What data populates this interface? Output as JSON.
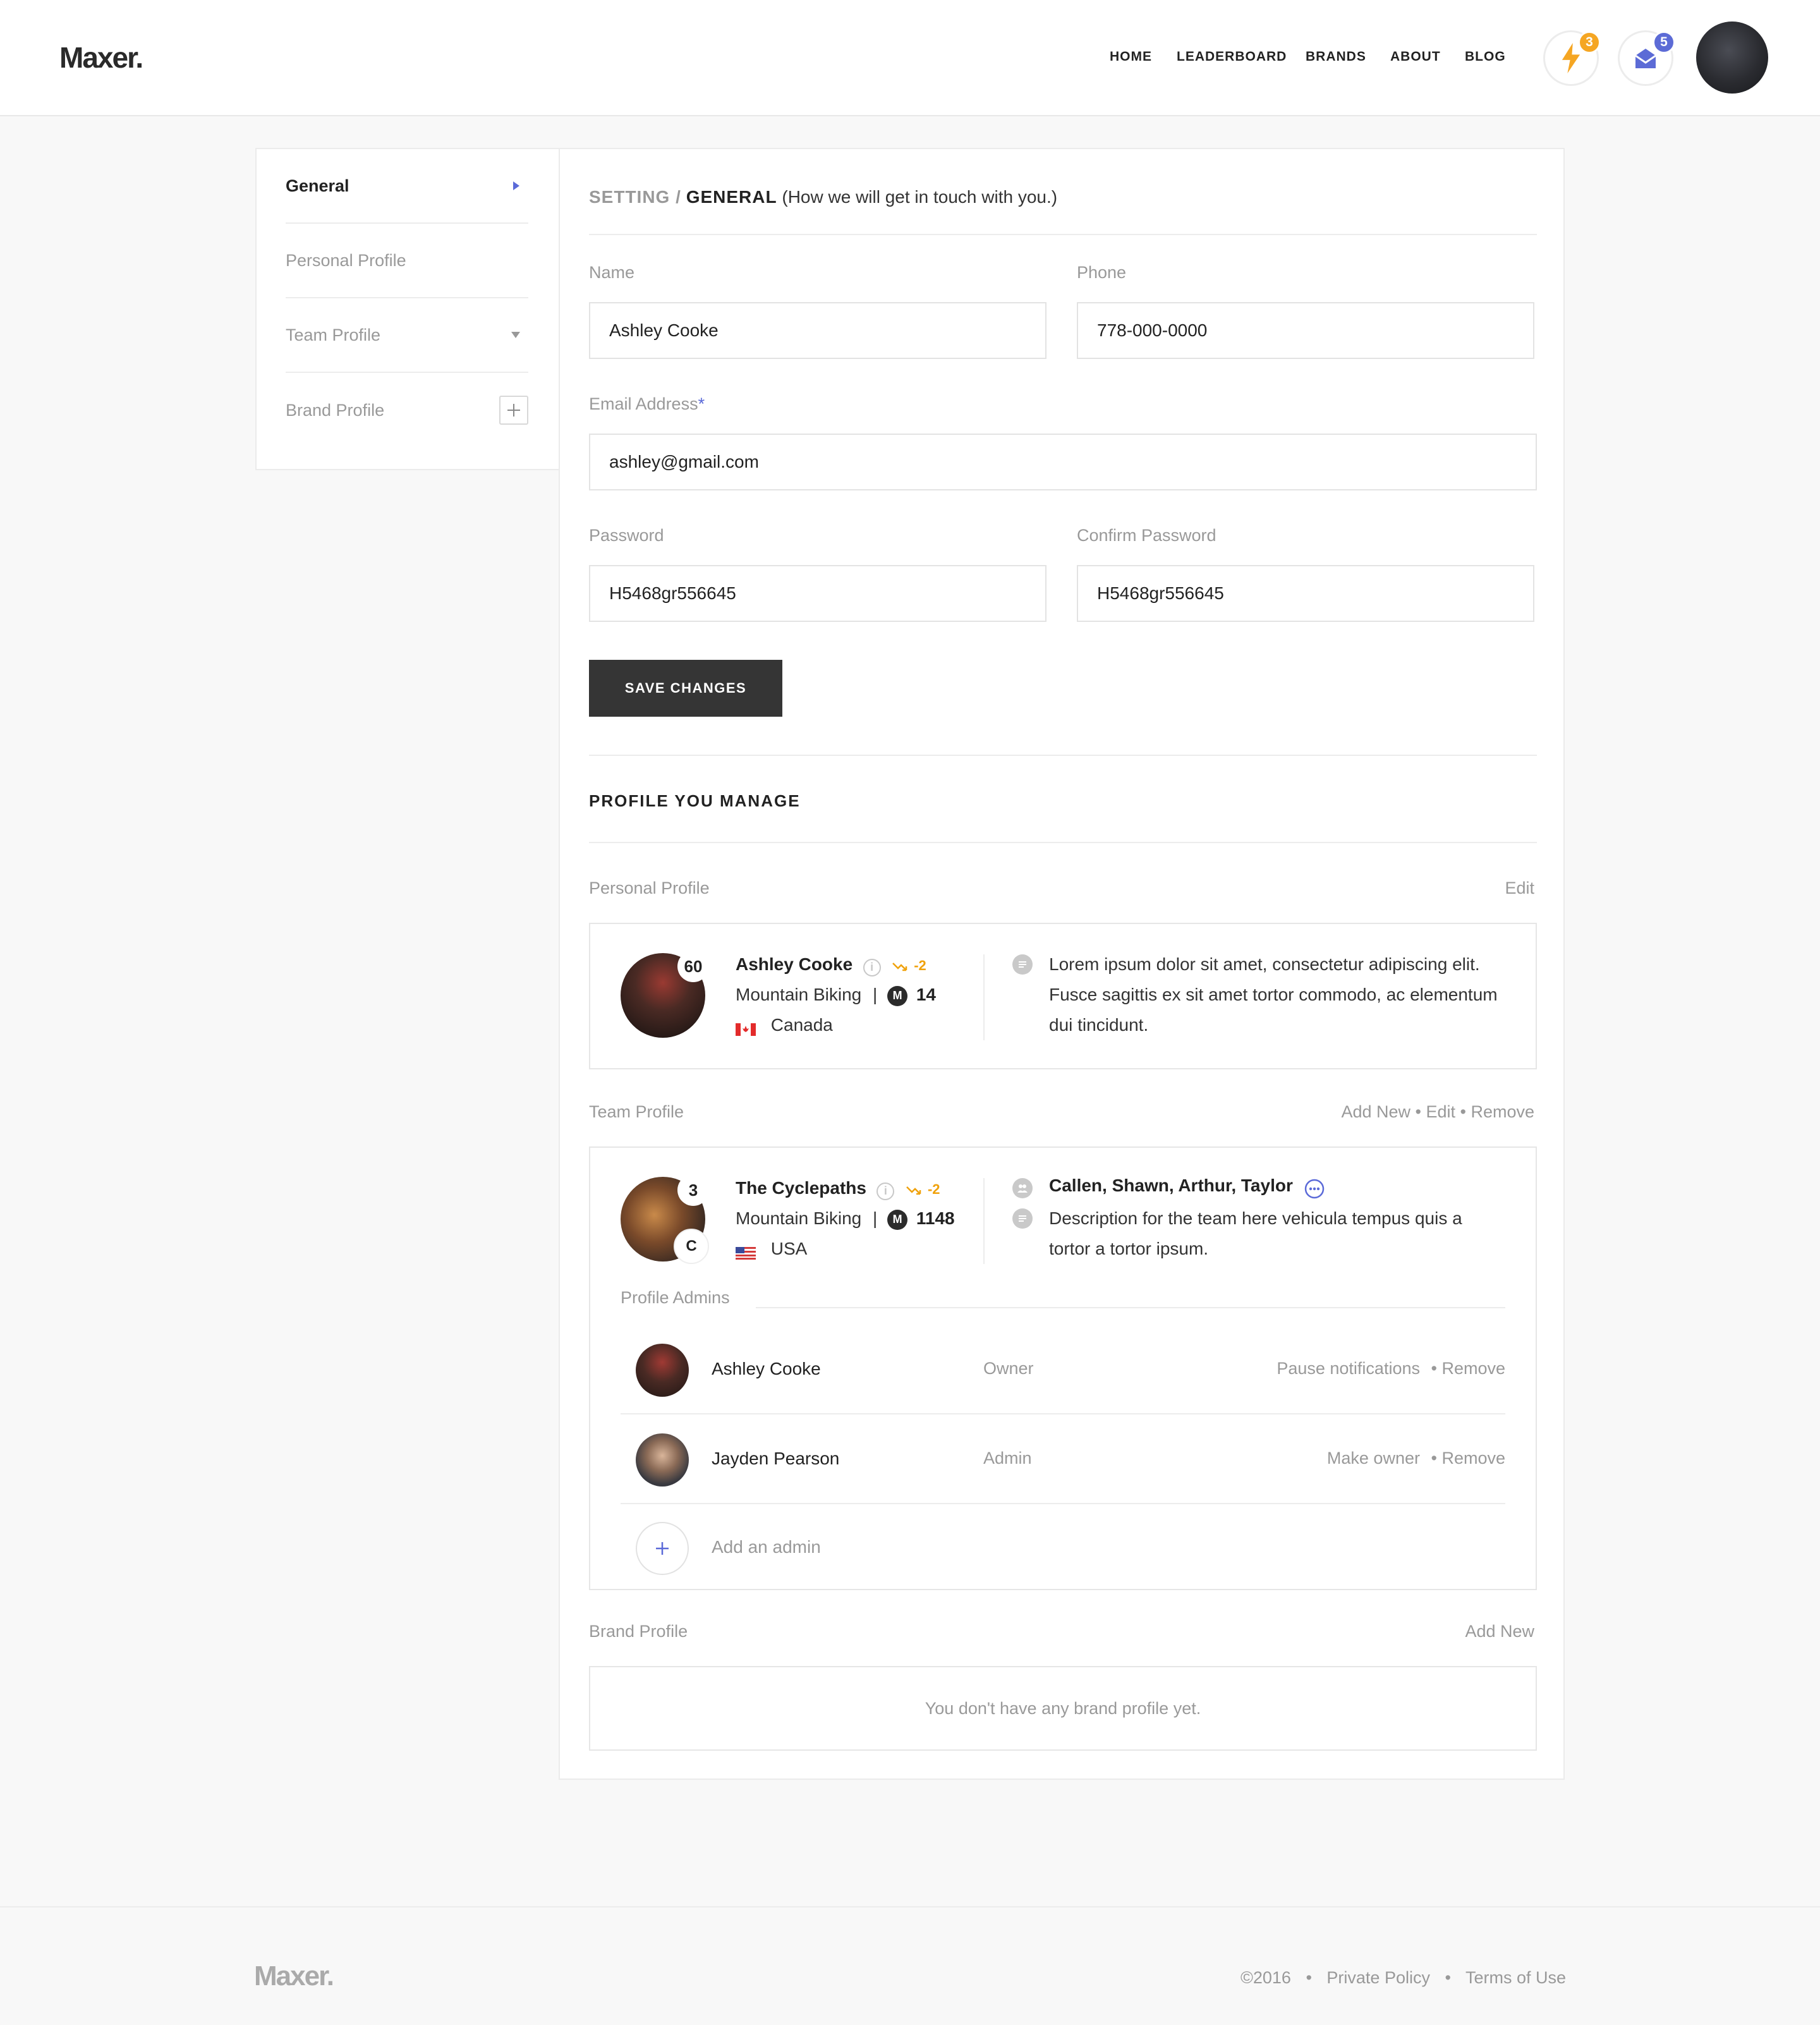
{
  "brand": {
    "logo": "Maxer."
  },
  "nav": {
    "items": [
      "HOME",
      "LEADERBOARD",
      "BRANDS",
      "ABOUT",
      "BLOG"
    ]
  },
  "header": {
    "notifications_count": "3",
    "messages_count": "5",
    "colors": {
      "notif_badge": "#f5a623",
      "msg_badge": "#5c6bd6",
      "accent": "#5b6ad8"
    }
  },
  "sidebar": {
    "items": [
      {
        "label": "General"
      },
      {
        "label": "Personal Profile"
      },
      {
        "label": "Team Profile"
      },
      {
        "label": "Brand Profile"
      }
    ]
  },
  "settings": {
    "crumb_root": "SETTING /",
    "crumb_current": "GENERAL",
    "crumb_note": "(How we will get in touch with you.)",
    "name_label": "Name",
    "name_value": "Ashley Cooke",
    "phone_label": "Phone",
    "phone_value": "778-000-0000",
    "email_label": "Email Address",
    "email_required": "*",
    "email_value": "ashley@gmail.com",
    "password_label": "Password",
    "password_value": "H5468gr556645",
    "confirm_label": "Confirm Password",
    "confirm_value": "H5468gr556645",
    "save_label": "SAVE CHANGES"
  },
  "manage": {
    "title": "PROFILE YOU MANAGE",
    "personal": {
      "section_label": "Personal Profile",
      "action": "Edit",
      "rank": "60",
      "name": "Ashley Cooke",
      "trend": "-2",
      "sport": "Mountain Biking",
      "sep": "|",
      "m_letter": "M",
      "score": "14",
      "country": "Canada",
      "bio_line1": "Lorem ipsum dolor sit amet, consectetur adipiscing elit.",
      "bio_line2": "Fusce sagittis ex sit amet tortor commodo, ac elementum",
      "bio_line3": "dui tincidunt."
    },
    "team": {
      "section_label": "Team Profile",
      "actions": "Add New • Edit • Remove",
      "rank": "3",
      "brand_letter": "C",
      "name": "The Cyclepaths",
      "trend": "-2",
      "sport": "Mountain Biking",
      "sep": "|",
      "m_letter": "M",
      "score": "1148",
      "country": "USA",
      "members": "Callen, Shawn, Arthur, Taylor",
      "desc_line1": "Description for the team here vehicula tempus quis a",
      "desc_line2": "tortor a tortor ipsum.",
      "admins_label": "Profile Admins",
      "admins": [
        {
          "name": "Ashley Cooke",
          "role": "Owner",
          "action_primary": "Pause notifications",
          "action_remove": "• Remove"
        },
        {
          "name": "Jayden Pearson",
          "role": "Admin",
          "action_primary": "Make owner",
          "action_remove": "• Remove"
        }
      ],
      "add_admin": "Add an admin"
    },
    "brand": {
      "section_label": "Brand Profile",
      "action": "Add New",
      "empty": "You don't have any brand profile yet."
    }
  },
  "footer": {
    "logo": "Maxer.",
    "copyright": "©2016",
    "dot": "•",
    "privacy": "Private Policy",
    "terms": "Terms of Use"
  }
}
